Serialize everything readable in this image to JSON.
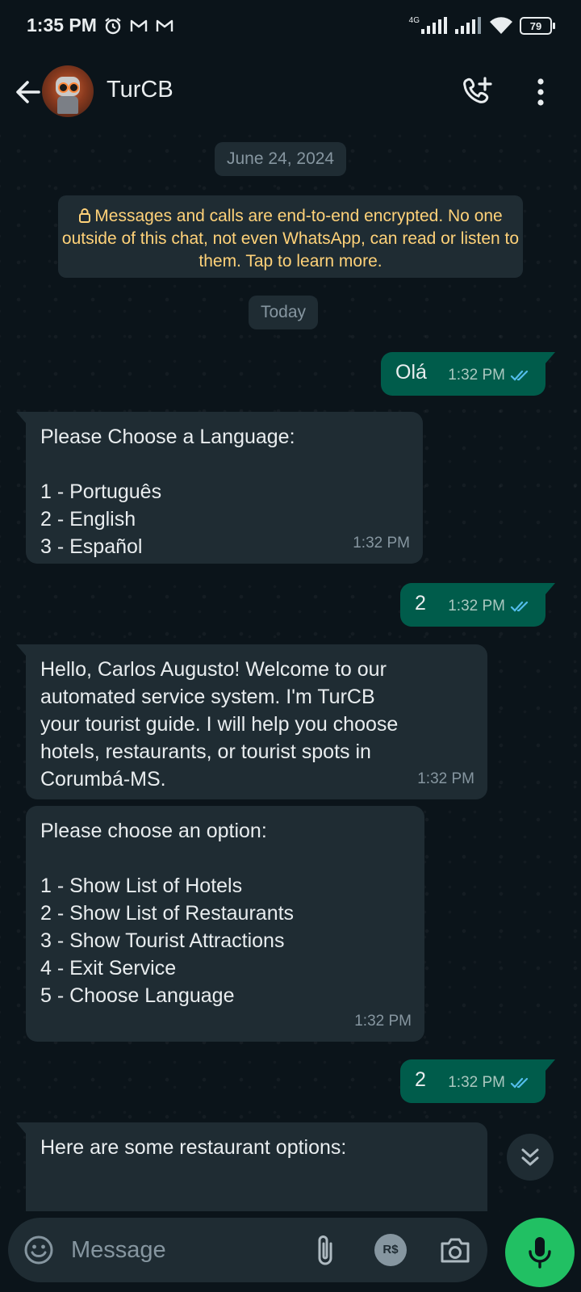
{
  "status_bar": {
    "time": "1:35 PM",
    "network": "4G",
    "battery": "79"
  },
  "header": {
    "contact_name": "TurCB"
  },
  "chat": {
    "date_divider": "June 24, 2024",
    "encryption_notice": "Messages and calls are end-to-end encrypted. No one outside of this chat, not even WhatsApp, can read or listen to them. Tap to learn more.",
    "today_divider": "Today",
    "messages": [
      {
        "direction": "outgoing",
        "text": "Olá",
        "time": "1:32 PM"
      },
      {
        "direction": "incoming",
        "text": "Please Choose a Language:\n\n1 - Português\n2 - English\n3 - Español",
        "time": "1:32 PM"
      },
      {
        "direction": "outgoing",
        "text": "2",
        "time": "1:32 PM"
      },
      {
        "direction": "incoming",
        "text": "Hello, Carlos Augusto! Welcome to our\nautomated service system. I'm TurCB\nyour tourist guide. I will help you choose\nhotels, restaurants, or tourist spots in\nCorumbá-MS.",
        "time": "1:32 PM"
      },
      {
        "direction": "incoming",
        "text": "Please choose an option:\n\n1 - Show List of Hotels\n2 - Show List of Restaurants\n3 - Show Tourist Attractions\n4 - Exit Service\n5 - Choose Language",
        "time": "1:32 PM"
      },
      {
        "direction": "outgoing",
        "text": "2",
        "time": "1:32 PM"
      },
      {
        "direction": "incoming",
        "text": "Here are some restaurant options:",
        "time": ""
      }
    ]
  },
  "composer": {
    "placeholder": "Message",
    "payment_label": "R$"
  },
  "colors": {
    "background": "#0b141a",
    "incoming_bubble": "#1f2c33",
    "outgoing_bubble": "#005c4b",
    "accent": "#21c063",
    "read_ticks": "#53bdeb"
  }
}
